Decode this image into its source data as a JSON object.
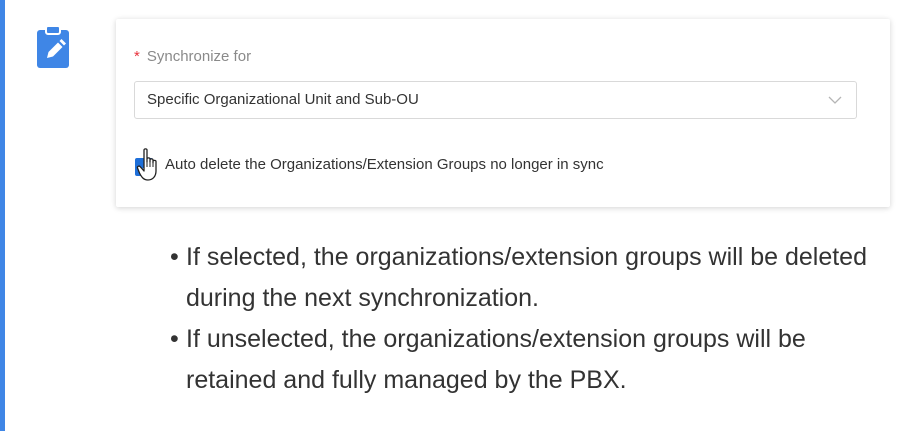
{
  "field": {
    "required_mark": "*",
    "label": "Synchronize for",
    "selected_value": "Specific Organizational Unit and Sub-OU"
  },
  "checkbox": {
    "checked": true,
    "label": "Auto delete the Organizations/Extension Groups no longer in sync"
  },
  "notes": [
    {
      "bullet": "•",
      "text": "If selected, the organizations/extension groups will be deleted during the next synchronization."
    },
    {
      "bullet": "•",
      "text": "If unselected, the organizations/extension groups will be retained and fully managed by the PBX."
    }
  ],
  "colors": {
    "accent": "#3f86e6",
    "checkbox": "#1e6fd9",
    "required": "#e8323c"
  },
  "icons": {
    "note": "edit-note-icon",
    "dropdown": "chevron-down-icon",
    "cursor": "hand-pointer-cursor"
  }
}
